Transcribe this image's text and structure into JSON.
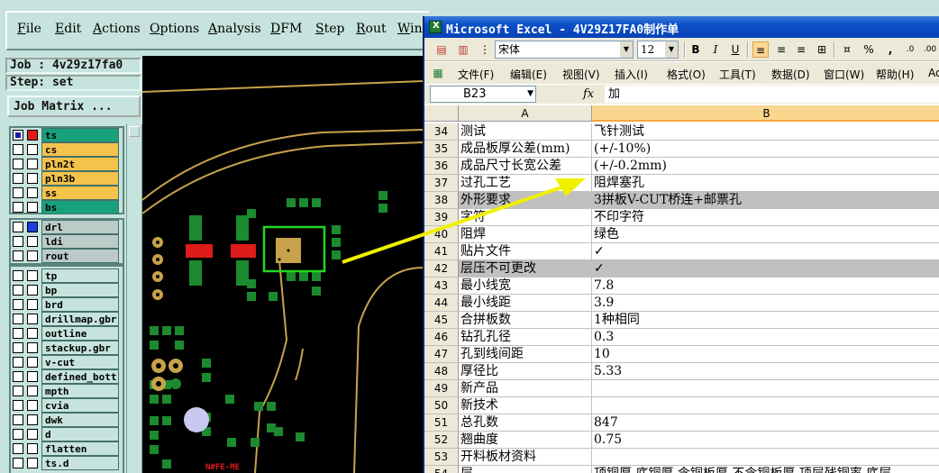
{
  "cam": {
    "menus": [
      "File",
      "Edit",
      "Actions",
      "Options",
      "Analysis",
      "DFM",
      "Step",
      "Rout",
      "Win"
    ],
    "job_label": "Job : 4v29z17fa0",
    "step_label": "Step: set",
    "job_matrix_button": "Job Matrix ...",
    "layers": [
      {
        "name": "ts",
        "color": "green",
        "sel": "on",
        "mark": "red"
      },
      {
        "name": "cs",
        "color": "yellow",
        "sel": "",
        "mark": ""
      },
      {
        "name": "pln2t",
        "color": "yellow",
        "sel": "",
        "mark": ""
      },
      {
        "name": "pln3b",
        "color": "yellow",
        "sel": "",
        "mark": ""
      },
      {
        "name": "ss",
        "color": "yellow",
        "sel": "",
        "mark": ""
      },
      {
        "name": "bs",
        "color": "green",
        "sel": "",
        "mark": ""
      },
      {
        "name": "drl",
        "color": "grey",
        "sel": "",
        "mark": "blue"
      },
      {
        "name": "ldi",
        "color": "grey",
        "sel": "",
        "mark": ""
      },
      {
        "name": "rout",
        "color": "grey",
        "sel": "",
        "mark": ""
      },
      {
        "name": "tp",
        "color": "teal",
        "sel": "",
        "mark": ""
      },
      {
        "name": "bp",
        "color": "teal",
        "sel": "",
        "mark": ""
      },
      {
        "name": "brd",
        "color": "teal",
        "sel": "",
        "mark": ""
      },
      {
        "name": "drillmap.gbr",
        "color": "teal",
        "sel": "",
        "mark": ""
      },
      {
        "name": "outline",
        "color": "teal",
        "sel": "",
        "mark": ""
      },
      {
        "name": "stackup.gbr",
        "color": "teal",
        "sel": "",
        "mark": ""
      },
      {
        "name": "v-cut",
        "color": "teal",
        "sel": "",
        "mark": ""
      },
      {
        "name": "defined_bott",
        "color": "teal",
        "sel": "",
        "mark": ""
      },
      {
        "name": "mpth",
        "color": "teal",
        "sel": "",
        "mark": ""
      },
      {
        "name": "cvia",
        "color": "teal",
        "sel": "",
        "mark": ""
      },
      {
        "name": "dwk",
        "color": "teal",
        "sel": "",
        "mark": ""
      },
      {
        "name": "d",
        "color": "teal",
        "sel": "",
        "mark": ""
      },
      {
        "name": "flatten",
        "color": "teal",
        "sel": "",
        "mark": ""
      },
      {
        "name": "ts.d",
        "color": "teal",
        "sel": "",
        "mark": ""
      }
    ]
  },
  "excel": {
    "title": "Microsoft Excel - 4V29Z17FA0制作单",
    "font_name": "宋体",
    "font_size": "12",
    "toolbar": [
      "B",
      "I",
      "U",
      "%",
      ","
    ],
    "menus": [
      "文件(F)",
      "编辑(E)",
      "视图(V)",
      "插入(I)",
      "格式(O)",
      "工具(T)",
      "数据(D)",
      "窗口(W)",
      "帮助(H)",
      "Ad"
    ],
    "name_box": "B23",
    "fx": "fx",
    "formula_value": "加",
    "col_a": "A",
    "col_b": "B",
    "rows": [
      {
        "n": "34",
        "a": "测试",
        "b": "飞针测试",
        "shaded": false
      },
      {
        "n": "35",
        "a": "成品板厚公差(mm)",
        "b": "(+/-10%)",
        "shaded": false
      },
      {
        "n": "36",
        "a": "成品尺寸长宽公差",
        "b": "(+/-0.2mm)",
        "shaded": false
      },
      {
        "n": "37",
        "a": "过孔工艺",
        "b": "阻焊塞孔",
        "shaded": false
      },
      {
        "n": "38",
        "a": "外形要求",
        "b": "3拼板V-CUT桥连+邮票孔",
        "shaded": true
      },
      {
        "n": "39",
        "a": "字符",
        "b": "不印字符",
        "shaded": false
      },
      {
        "n": "40",
        "a": "阻焊",
        "b": "绿色",
        "shaded": false
      },
      {
        "n": "41",
        "a": "贴片文件",
        "b": "✓",
        "shaded": false
      },
      {
        "n": "42",
        "a": "层压不可更改",
        "b": "✓",
        "shaded": true
      },
      {
        "n": "43",
        "a": "最小线宽",
        "b": "7.8",
        "shaded": false
      },
      {
        "n": "44",
        "a": "最小线距",
        "b": "3.9",
        "shaded": false
      },
      {
        "n": "45",
        "a": "合拼板数",
        "b": "1种相同",
        "shaded": false
      },
      {
        "n": "46",
        "a": "钻孔孔径",
        "b": "0.3",
        "shaded": false
      },
      {
        "n": "47",
        "a": "孔到线间距",
        "b": "10",
        "shaded": false
      },
      {
        "n": "48",
        "a": "厚径比",
        "b": "5.33",
        "shaded": false
      },
      {
        "n": "49",
        "a": "新产品",
        "b": "",
        "shaded": false
      },
      {
        "n": "50",
        "a": "新技术",
        "b": "",
        "shaded": false
      },
      {
        "n": "51",
        "a": "总孔数",
        "b": "847",
        "shaded": false
      },
      {
        "n": "52",
        "a": "翘曲度",
        "b": "0.75",
        "shaded": false
      },
      {
        "n": "53",
        "a": "开料板材资料",
        "b": "",
        "shaded": false
      },
      {
        "n": "54",
        "a": "层",
        "b": "顶铜厚 底铜厚 含铜板厚 不含铜板厚 顶层残铜率 底层",
        "shaded": false
      }
    ]
  },
  "colors": {
    "cam_bg": "#c6e4dd",
    "layer_green": "#19a07c",
    "layer_yellow": "#f4c34c",
    "excel_title": "#0a4fc6",
    "arrow": "#f0f000"
  }
}
